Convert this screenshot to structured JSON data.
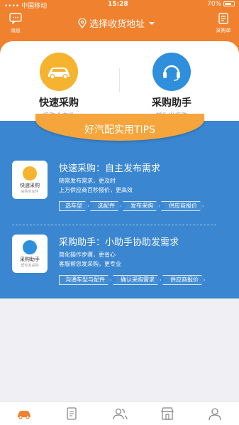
{
  "status_bar": {
    "carrier": "•••• 中国移动 ",
    "time": "15:28",
    "battery": "70%"
  },
  "header": {
    "left_button": {
      "label": "消息",
      "icon": "message-icon"
    },
    "address": "选择收货地址",
    "right_button": {
      "label": "采购单",
      "icon": "order-list-icon"
    }
  },
  "options": [
    {
      "title": "快速采购",
      "subtitle": "采购全车件",
      "icon": "car-icon"
    },
    {
      "title": "采购助手",
      "subtitle": "帮你发采购",
      "icon": "headset-icon"
    }
  ],
  "tips_title": "好汽配实用TIPS",
  "items": [
    {
      "thumb_title": "快速采购",
      "thumb_sub": "采购全车件",
      "heading": "快速采购：自主发布需求",
      "line1": "随需发布需求，更及时",
      "line2": "上万供应商百秒报价，更高效",
      "steps": [
        "选车型",
        "选配件",
        "发布采购",
        "供应商报价"
      ]
    },
    {
      "thumb_title": "采购助手",
      "thumb_sub": "帮你发采购",
      "heading": "采购助手：小助手协助发需求",
      "line1": "简化操作步骤，更省心",
      "line2": "客服帮您发采购，更专业",
      "steps": [
        "沟通车型与配件",
        "确认采购需求",
        "供应商报价"
      ]
    }
  ],
  "tabbar": [
    {
      "icon": "car-icon",
      "active": true
    },
    {
      "icon": "clipboard-icon",
      "active": false
    },
    {
      "icon": "contacts-icon",
      "active": false
    },
    {
      "icon": "store-icon",
      "active": false
    },
    {
      "icon": "user-icon",
      "active": false
    }
  ],
  "colors": {
    "primary": "#f0812e",
    "panel": "#3a86d0",
    "tips": "#f5a53c"
  }
}
